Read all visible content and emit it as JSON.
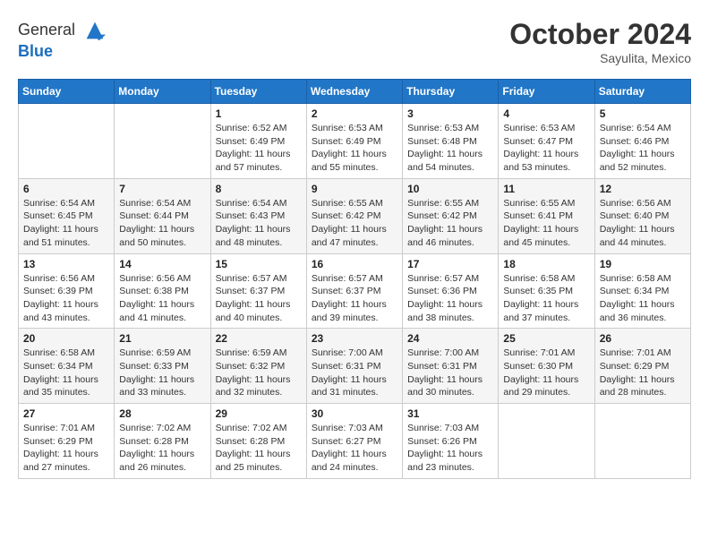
{
  "logo": {
    "general": "General",
    "blue": "Blue"
  },
  "header": {
    "month": "October 2024",
    "location": "Sayulita, Mexico"
  },
  "weekdays": [
    "Sunday",
    "Monday",
    "Tuesday",
    "Wednesday",
    "Thursday",
    "Friday",
    "Saturday"
  ],
  "weeks": [
    [
      {
        "day": null
      },
      {
        "day": null
      },
      {
        "day": 1,
        "sunrise": "6:52 AM",
        "sunset": "6:49 PM",
        "daylight": "11 hours and 57 minutes."
      },
      {
        "day": 2,
        "sunrise": "6:53 AM",
        "sunset": "6:49 PM",
        "daylight": "11 hours and 55 minutes."
      },
      {
        "day": 3,
        "sunrise": "6:53 AM",
        "sunset": "6:48 PM",
        "daylight": "11 hours and 54 minutes."
      },
      {
        "day": 4,
        "sunrise": "6:53 AM",
        "sunset": "6:47 PM",
        "daylight": "11 hours and 53 minutes."
      },
      {
        "day": 5,
        "sunrise": "6:54 AM",
        "sunset": "6:46 PM",
        "daylight": "11 hours and 52 minutes."
      }
    ],
    [
      {
        "day": 6,
        "sunrise": "6:54 AM",
        "sunset": "6:45 PM",
        "daylight": "11 hours and 51 minutes."
      },
      {
        "day": 7,
        "sunrise": "6:54 AM",
        "sunset": "6:44 PM",
        "daylight": "11 hours and 50 minutes."
      },
      {
        "day": 8,
        "sunrise": "6:54 AM",
        "sunset": "6:43 PM",
        "daylight": "11 hours and 48 minutes."
      },
      {
        "day": 9,
        "sunrise": "6:55 AM",
        "sunset": "6:42 PM",
        "daylight": "11 hours and 47 minutes."
      },
      {
        "day": 10,
        "sunrise": "6:55 AM",
        "sunset": "6:42 PM",
        "daylight": "11 hours and 46 minutes."
      },
      {
        "day": 11,
        "sunrise": "6:55 AM",
        "sunset": "6:41 PM",
        "daylight": "11 hours and 45 minutes."
      },
      {
        "day": 12,
        "sunrise": "6:56 AM",
        "sunset": "6:40 PM",
        "daylight": "11 hours and 44 minutes."
      }
    ],
    [
      {
        "day": 13,
        "sunrise": "6:56 AM",
        "sunset": "6:39 PM",
        "daylight": "11 hours and 43 minutes."
      },
      {
        "day": 14,
        "sunrise": "6:56 AM",
        "sunset": "6:38 PM",
        "daylight": "11 hours and 41 minutes."
      },
      {
        "day": 15,
        "sunrise": "6:57 AM",
        "sunset": "6:37 PM",
        "daylight": "11 hours and 40 minutes."
      },
      {
        "day": 16,
        "sunrise": "6:57 AM",
        "sunset": "6:37 PM",
        "daylight": "11 hours and 39 minutes."
      },
      {
        "day": 17,
        "sunrise": "6:57 AM",
        "sunset": "6:36 PM",
        "daylight": "11 hours and 38 minutes."
      },
      {
        "day": 18,
        "sunrise": "6:58 AM",
        "sunset": "6:35 PM",
        "daylight": "11 hours and 37 minutes."
      },
      {
        "day": 19,
        "sunrise": "6:58 AM",
        "sunset": "6:34 PM",
        "daylight": "11 hours and 36 minutes."
      }
    ],
    [
      {
        "day": 20,
        "sunrise": "6:58 AM",
        "sunset": "6:34 PM",
        "daylight": "11 hours and 35 minutes."
      },
      {
        "day": 21,
        "sunrise": "6:59 AM",
        "sunset": "6:33 PM",
        "daylight": "11 hours and 33 minutes."
      },
      {
        "day": 22,
        "sunrise": "6:59 AM",
        "sunset": "6:32 PM",
        "daylight": "11 hours and 32 minutes."
      },
      {
        "day": 23,
        "sunrise": "7:00 AM",
        "sunset": "6:31 PM",
        "daylight": "11 hours and 31 minutes."
      },
      {
        "day": 24,
        "sunrise": "7:00 AM",
        "sunset": "6:31 PM",
        "daylight": "11 hours and 30 minutes."
      },
      {
        "day": 25,
        "sunrise": "7:01 AM",
        "sunset": "6:30 PM",
        "daylight": "11 hours and 29 minutes."
      },
      {
        "day": 26,
        "sunrise": "7:01 AM",
        "sunset": "6:29 PM",
        "daylight": "11 hours and 28 minutes."
      }
    ],
    [
      {
        "day": 27,
        "sunrise": "7:01 AM",
        "sunset": "6:29 PM",
        "daylight": "11 hours and 27 minutes."
      },
      {
        "day": 28,
        "sunrise": "7:02 AM",
        "sunset": "6:28 PM",
        "daylight": "11 hours and 26 minutes."
      },
      {
        "day": 29,
        "sunrise": "7:02 AM",
        "sunset": "6:28 PM",
        "daylight": "11 hours and 25 minutes."
      },
      {
        "day": 30,
        "sunrise": "7:03 AM",
        "sunset": "6:27 PM",
        "daylight": "11 hours and 24 minutes."
      },
      {
        "day": 31,
        "sunrise": "7:03 AM",
        "sunset": "6:26 PM",
        "daylight": "11 hours and 23 minutes."
      },
      {
        "day": null
      },
      {
        "day": null
      }
    ]
  ],
  "labels": {
    "sunrise": "Sunrise:",
    "sunset": "Sunset:",
    "daylight": "Daylight:"
  }
}
